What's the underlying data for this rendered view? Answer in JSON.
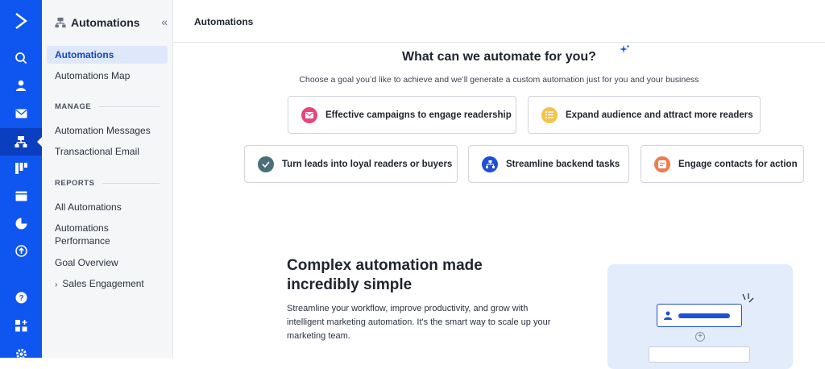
{
  "rail": {
    "icons": [
      "logo-chevron-icon",
      "search-icon",
      "contacts-icon",
      "campaigns-icon",
      "automations-icon",
      "deals-icon",
      "website-icon",
      "reports-icon",
      "upload-icon",
      "help-icon",
      "apps-icon",
      "settings-icon"
    ]
  },
  "nav": {
    "title": "Automations",
    "items": {
      "automations": "Automations",
      "automations_map": "Automations Map",
      "automation_messages": "Automation Messages",
      "transactional_email": "Transactional Email",
      "all_automations": "All Automations",
      "automations_performance": "Automations Performance",
      "goal_overview": "Goal Overview",
      "sales_engagement": "Sales Engagement"
    },
    "sections": {
      "manage": "MANAGE",
      "reports": "REPORTS"
    }
  },
  "topbar": {
    "title": "Automations"
  },
  "main": {
    "heading": "What can we automate for you?",
    "subheading": "Choose a goal you’d like to achieve and we’ll generate a custom automation just for you and your business",
    "goals": [
      {
        "label": "Effective campaigns to engage readership",
        "color": "#e8457a",
        "icon": "envelope-icon"
      },
      {
        "label": "Expand audience and attract more readers",
        "color": "#f4c24d",
        "icon": "list-icon"
      },
      {
        "label": "Turn leads into loyal readers or buyers",
        "color": "#4a6f78",
        "icon": "check-icon"
      },
      {
        "label": "Streamline backend tasks",
        "color": "#1f4fd6",
        "icon": "workflow-icon"
      },
      {
        "label": "Engage contacts for action",
        "color": "#f07b4f",
        "icon": "message-icon"
      }
    ],
    "promo_title": "Complex automation made incredibly simple",
    "promo_text": "Streamline your workflow, improve productivity, and grow with intelligent marketing automation. It's the smart way to scale up your marketing team."
  },
  "colors": {
    "rail": "#0f55f0",
    "accent": "#1046c9"
  }
}
